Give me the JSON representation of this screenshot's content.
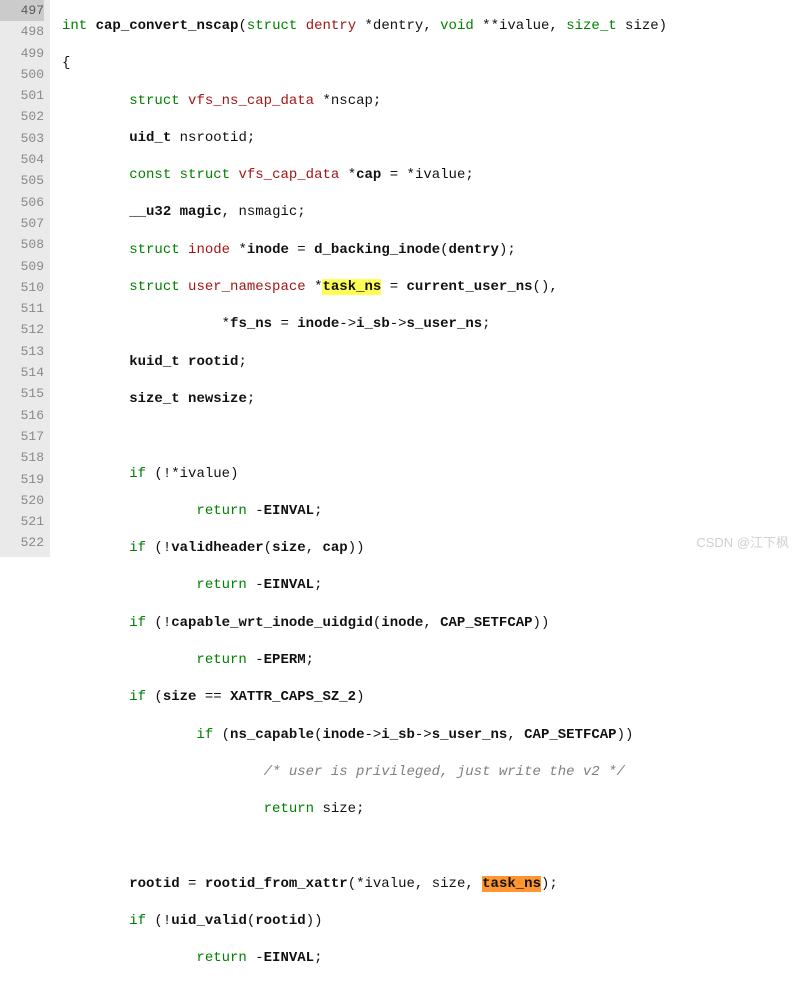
{
  "gutter": {
    "current": 497,
    "lines": [
      497,
      498,
      499,
      500,
      501,
      502,
      503,
      504,
      505,
      506,
      507,
      508,
      509,
      510,
      511,
      512,
      513,
      514,
      515,
      516,
      517,
      518,
      519,
      520,
      521,
      522
    ]
  },
  "code": {
    "l497": {
      "kw1": "int",
      "func": "cap_convert_nscap",
      "p1": "(",
      "kw2": "struct",
      "type1": "dentry",
      "star1": "*",
      "arg1": "dentry",
      "comma1": ", ",
      "kw3": "void",
      "star2": " **",
      "arg2": "ivalue",
      "comma2": ", ",
      "type2": "size_t",
      "sp": " ",
      "arg3": "size",
      "p2": ")"
    },
    "l498": {
      "brace": "{"
    },
    "l499": {
      "kw": "struct",
      "type": "vfs_ns_cap_data",
      "star": " *",
      "var": "nscap",
      "semi": ";"
    },
    "l500": {
      "type": "uid_t",
      "sp": " ",
      "var": "nsrootid",
      "semi": ";"
    },
    "l501": {
      "kw1": "const",
      "kw2": "struct",
      "type": "vfs_cap_data",
      "star": " *",
      "var": "cap",
      "eq": " = *",
      "rhs": "ivalue",
      "semi": ";"
    },
    "l502": {
      "type": "__u32",
      "sp": " ",
      "var1": "magic",
      "comma": ", ",
      "var2": "nsmagic",
      "semi": ";"
    },
    "l503": {
      "kw": "struct",
      "type": "inode",
      "star": " *",
      "var": "inode",
      "eq": " = ",
      "func": "d_backing_inode",
      "p1": "(",
      "arg": "dentry",
      "p2": ")",
      "semi": ";"
    },
    "l504": {
      "kw": "struct",
      "type": "user_namespace",
      "star": " *",
      "hl": "task_ns",
      "eq": " = ",
      "func": "current_user_ns",
      "p1": "()",
      "comma": ","
    },
    "l505": {
      "star": "*",
      "var": "fs_ns",
      "eq": " = ",
      "v1": "inode",
      "arr1": "->",
      "v2": "i_sb",
      "arr2": "->",
      "v3": "s_user_ns",
      "semi": ";"
    },
    "l506": {
      "type": "kuid_t",
      "sp": " ",
      "var": "rootid",
      "semi": ";"
    },
    "l507": {
      "type": "size_t",
      "sp": " ",
      "var": "newsize",
      "semi": ";"
    },
    "l509": {
      "kw": "if",
      "p1": " (!*",
      "var": "ivalue",
      "p2": ")"
    },
    "l510": {
      "kw": "return",
      "sp": " -",
      "val": "EINVAL",
      "semi": ";"
    },
    "l511": {
      "kw": "if",
      "p1": " (!",
      "func": "validheader",
      "p2": "(",
      "arg1": "size",
      "comma": ", ",
      "arg2": "cap",
      "p3": "))"
    },
    "l512": {
      "kw": "return",
      "sp": " -",
      "val": "EINVAL",
      "semi": ";"
    },
    "l513": {
      "kw": "if",
      "p1": " (!",
      "func": "capable_wrt_inode_uidgid",
      "p2": "(",
      "arg1": "inode",
      "comma": ", ",
      "arg2": "CAP_SETFCAP",
      "p3": "))"
    },
    "l514": {
      "kw": "return",
      "sp": " -",
      "val": "EPERM",
      "semi": ";"
    },
    "l515": {
      "kw": "if",
      "p1": " (",
      "var": "size",
      "eq": " == ",
      "val": "XATTR_CAPS_SZ_2",
      "p2": ")"
    },
    "l516": {
      "kw": "if",
      "p1": " (",
      "func": "ns_capable",
      "p2": "(",
      "v1": "inode",
      "arr1": "->",
      "v2": "i_sb",
      "arr2": "->",
      "v3": "s_user_ns",
      "comma": ", ",
      "arg2": "CAP_SETFCAP",
      "p3": "))"
    },
    "l517": {
      "comment": "/* user is privileged, just write the v2 */"
    },
    "l518": {
      "kw": "return",
      "sp": " ",
      "val": "size",
      "semi": ";"
    },
    "l520": {
      "var": "rootid",
      "eq": " = ",
      "func": "rootid_from_xattr",
      "p1": "(*",
      "arg1": "ivalue",
      "comma1": ", ",
      "arg2": "size",
      "comma2": ", ",
      "hl": "task_ns",
      "p2": ")",
      "semi": ";"
    },
    "l521": {
      "kw": "if",
      "p1": " (!",
      "func": "uid_valid",
      "p2": "(",
      "arg": "rootid",
      "p3": "))"
    },
    "l522": {
      "kw": "return",
      "sp": " -",
      "val": "EINVAL",
      "semi": ";"
    }
  },
  "watermark": "CSDN @江下枫"
}
